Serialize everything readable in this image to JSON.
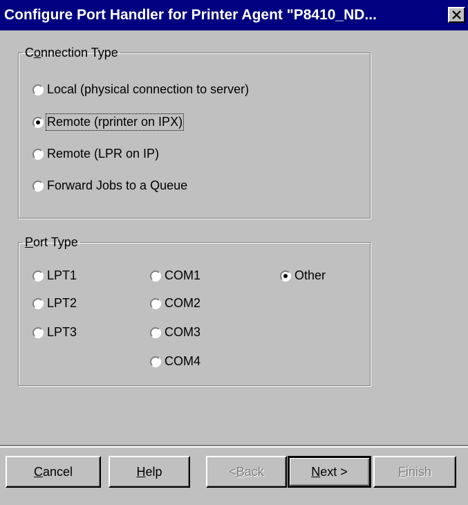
{
  "window": {
    "title": "Configure Port Handler for Printer Agent \"P8410_ND...",
    "close_icon": "close-x-icon"
  },
  "connection_type": {
    "legend_pre": "C",
    "legend_mn": "o",
    "legend_post": "nnection Type",
    "options": [
      {
        "label": "Local (physical connection to server)",
        "selected": false
      },
      {
        "label": "Remote (rprinter on IPX)",
        "selected": true
      },
      {
        "label": "Remote (LPR on IP)",
        "selected": false
      },
      {
        "label": "Forward Jobs to a Queue",
        "selected": false
      }
    ]
  },
  "port_type": {
    "legend_mn": "P",
    "legend_post": "ort Type",
    "options": [
      {
        "label": "LPT1",
        "selected": false
      },
      {
        "label": "LPT2",
        "selected": false
      },
      {
        "label": "LPT3",
        "selected": false
      },
      {
        "label": "COM1",
        "selected": false
      },
      {
        "label": "COM2",
        "selected": false
      },
      {
        "label": "COM3",
        "selected": false
      },
      {
        "label": "COM4",
        "selected": false
      },
      {
        "label": "Other",
        "selected": true
      }
    ]
  },
  "buttons": {
    "cancel": {
      "mn": "C",
      "rest": "ancel"
    },
    "help": {
      "mn": "H",
      "rest": "elp"
    },
    "back": {
      "pre": "< ",
      "mn": "B",
      "rest": "ack"
    },
    "next": {
      "mn": "N",
      "rest": "ext >"
    },
    "finish": {
      "mn": "F",
      "rest": "inish"
    }
  }
}
